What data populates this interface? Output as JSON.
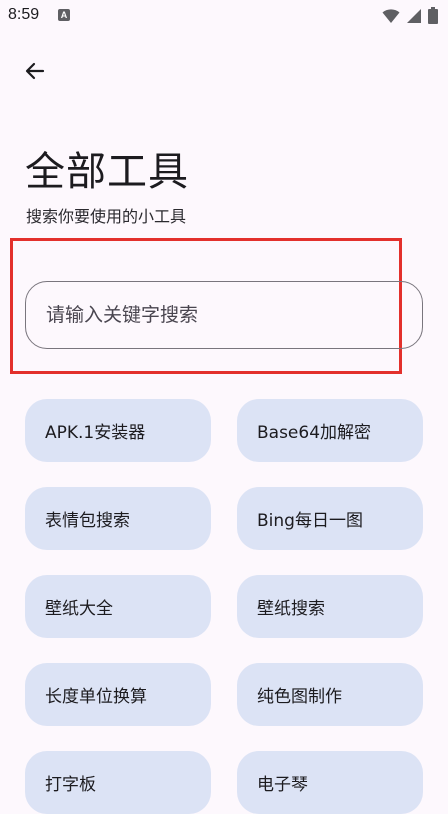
{
  "status_bar": {
    "time": "8:59",
    "notification_icon": "a-letter-icon",
    "icons": [
      "wifi-icon",
      "signal-icon",
      "battery-icon"
    ]
  },
  "header": {
    "back_icon": "arrow-left-icon",
    "title": "全部工具",
    "subtitle": "搜索你要使用的小工具"
  },
  "search": {
    "placeholder": "请输入关键字搜索",
    "value": ""
  },
  "tools": [
    {
      "label": "APK.1安装器"
    },
    {
      "label": "Base64加解密"
    },
    {
      "label": "表情包搜索"
    },
    {
      "label": "Bing每日一图"
    },
    {
      "label": "壁纸大全"
    },
    {
      "label": "壁纸搜索"
    },
    {
      "label": "长度单位换算"
    },
    {
      "label": "纯色图制作"
    },
    {
      "label": "打字板"
    },
    {
      "label": "电子琴"
    }
  ],
  "colors": {
    "background": "#fdf8fd",
    "chip": "#dce3f5",
    "highlight": "#e3302c",
    "outline": "#79757d"
  }
}
